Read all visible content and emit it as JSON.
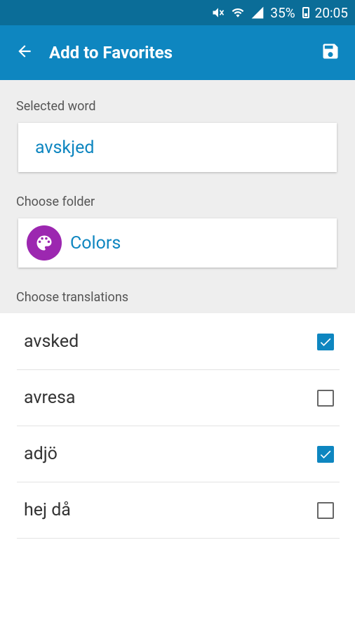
{
  "status_bar": {
    "battery": "35%",
    "time": "20:05",
    "icons": [
      "mute-icon",
      "wifi-icon",
      "signal-icon",
      "battery-icon"
    ]
  },
  "app_bar": {
    "title": "Add to Favorites",
    "back_icon": "arrow-back-icon",
    "save_icon": "save-icon"
  },
  "form": {
    "selected_word_label": "Selected word",
    "selected_word": "avskjed",
    "choose_folder_label": "Choose folder",
    "folder": {
      "name": "Colors",
      "icon": "palette-icon",
      "color": "#9c27b0"
    },
    "choose_translations_label": "Choose translations"
  },
  "translations": [
    {
      "text": "avsked",
      "checked": true
    },
    {
      "text": "avresa",
      "checked": false
    },
    {
      "text": "adjö",
      "checked": true
    },
    {
      "text": "hej då",
      "checked": false
    }
  ],
  "colors": {
    "status_bar": "#0b6d98",
    "app_bar": "#0e86c0",
    "accent": "#0e86c0",
    "folder_icon_bg": "#9c27b0"
  }
}
